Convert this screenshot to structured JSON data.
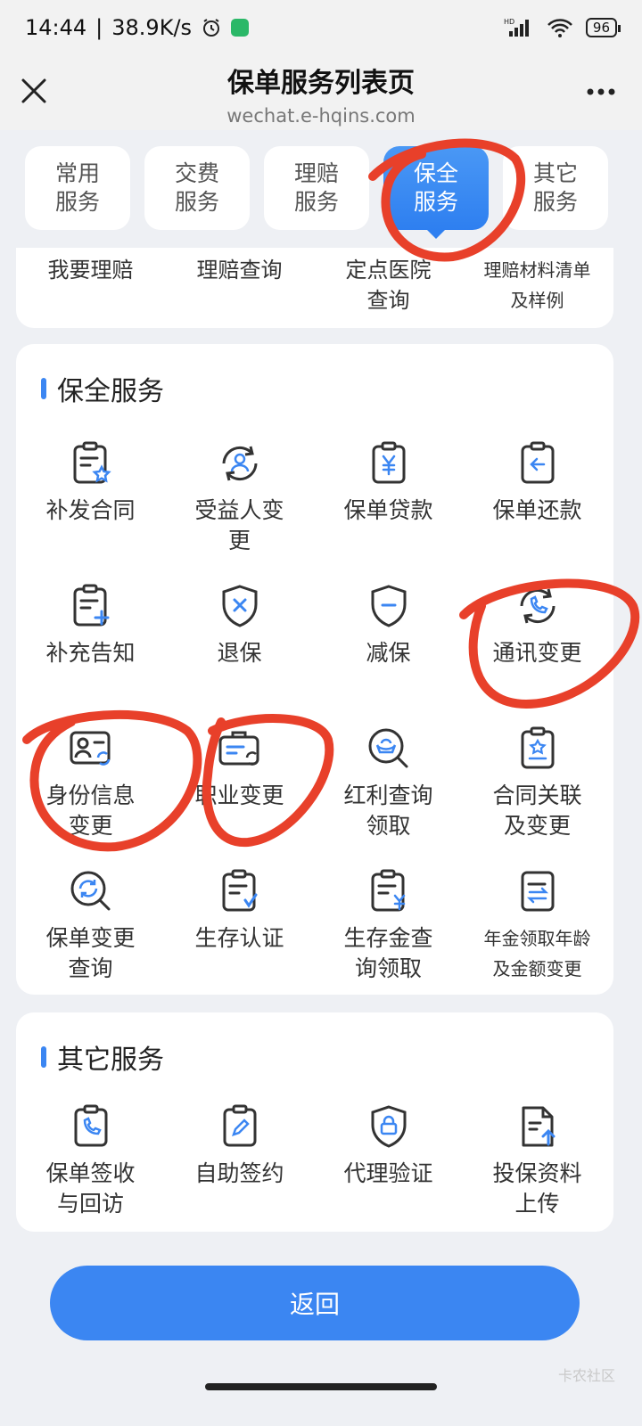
{
  "status_bar": {
    "time": "14:44",
    "separator": "|",
    "network_speed": "38.9K/s",
    "battery": "96",
    "icons": [
      "alarm-icon",
      "wechat-icon",
      "hd-signal-icon",
      "wifi-icon",
      "battery-icon"
    ]
  },
  "title_bar": {
    "title": "保单服务列表页",
    "url": "wechat.e-hqins.com",
    "close_icon": "close-icon",
    "more_icon": "more-icon"
  },
  "tabs": [
    {
      "label": "常用\n服务",
      "active": false
    },
    {
      "label": "交费\n服务",
      "active": false
    },
    {
      "label": "理赔\n服务",
      "active": false
    },
    {
      "label": "保全\n服务",
      "active": true
    },
    {
      "label": "其它\n服务",
      "active": false
    }
  ],
  "claims_row": [
    {
      "label": "我要理赔"
    },
    {
      "label": "理赔查询"
    },
    {
      "label": "定点医院\n查询"
    },
    {
      "label": "理赔材料清单\n及样例"
    }
  ],
  "security_section": {
    "title": "保全服务",
    "items": [
      {
        "label": "补发合同",
        "icon": "contract-star-icon"
      },
      {
        "label": "受益人变\n更",
        "icon": "beneficiary-refresh-icon"
      },
      {
        "label": "保单贷款",
        "icon": "loan-yen-icon"
      },
      {
        "label": "保单还款",
        "icon": "repay-arrow-icon"
      },
      {
        "label": "补充告知",
        "icon": "notice-plus-icon"
      },
      {
        "label": "退保",
        "icon": "shield-cross-icon"
      },
      {
        "label": "减保",
        "icon": "shield-minus-icon"
      },
      {
        "label": "通讯变更",
        "icon": "phone-refresh-icon"
      },
      {
        "label": "身份信息\n变更",
        "icon": "id-card-refresh-icon"
      },
      {
        "label": "职业变更",
        "icon": "briefcase-refresh-icon"
      },
      {
        "label": "红利查询\n领取",
        "icon": "ingot-search-icon"
      },
      {
        "label": "合同关联\n及变更",
        "icon": "contract-link-icon"
      },
      {
        "label": "保单变更\n查询",
        "icon": "search-refresh-icon"
      },
      {
        "label": "生存认证",
        "icon": "doc-check-icon"
      },
      {
        "label": "生存金查\n询领取",
        "icon": "doc-yen-icon"
      },
      {
        "label": "年金领取年龄\n及金额变更",
        "icon": "doc-swap-icon"
      }
    ]
  },
  "other_section": {
    "title": "其它服务",
    "items": [
      {
        "label": "保单签收\n与回访",
        "icon": "phone-doc-icon"
      },
      {
        "label": "自助签约",
        "icon": "pen-doc-icon"
      },
      {
        "label": "代理验证",
        "icon": "shield-lock-icon"
      },
      {
        "label": "投保资料\n上传",
        "icon": "doc-upload-icon"
      }
    ]
  },
  "return_button": {
    "label": "返回"
  },
  "watermark": "卡农社区",
  "colors": {
    "accent": "#3b86f2",
    "annotation": "#e8402a",
    "background": "#eef0f4"
  }
}
